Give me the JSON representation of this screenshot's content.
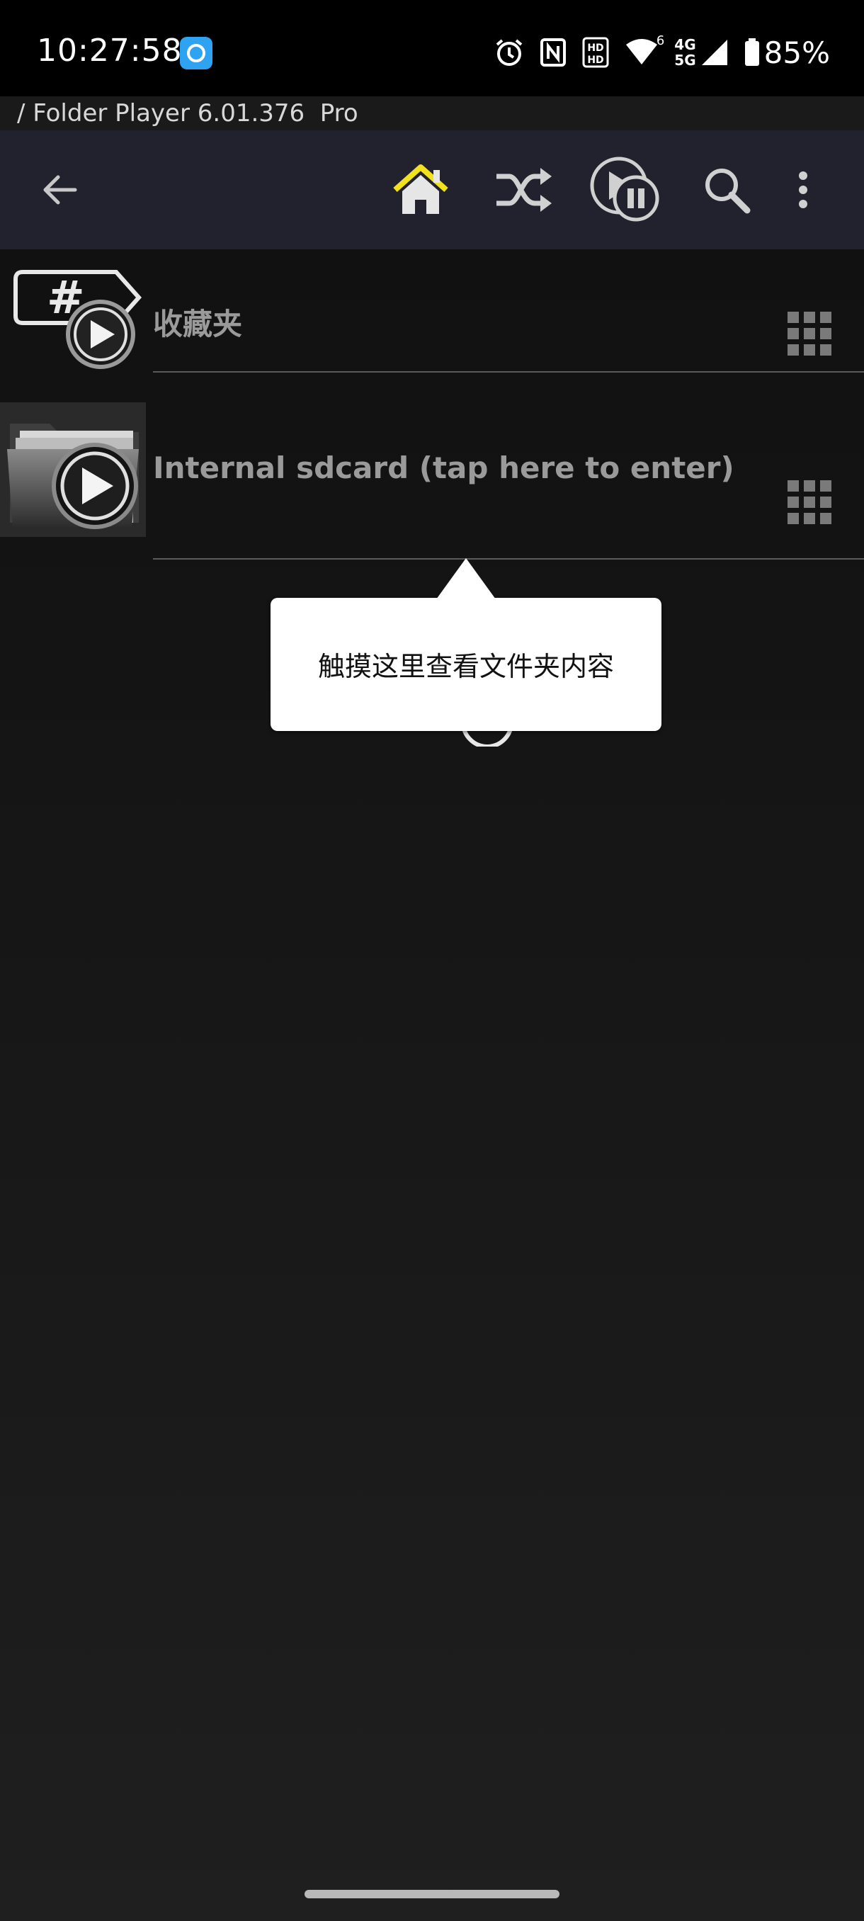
{
  "status_bar": {
    "time": "10:27:58",
    "network_label_top": "4G",
    "network_label_bottom": "5G",
    "wifi_label": "6",
    "battery_percent": "85%",
    "icons": [
      "app-notification-icon",
      "alarm-icon",
      "nfc-icon",
      "sim-hd-icon",
      "wifi-icon",
      "cellular-signal-icon",
      "battery-icon"
    ]
  },
  "title_bar": {
    "path": "/ Folder Player 6.01.376  Pro"
  },
  "toolbar": {
    "icons": [
      "back-arrow-icon",
      "home-icon",
      "shuffle-icon",
      "play-pause-icon",
      "search-icon",
      "more-vert-icon"
    ],
    "home_color": "#f2e11f"
  },
  "list": {
    "items": [
      {
        "label": "收藏夹",
        "icon": "tag-play-icon"
      },
      {
        "label": "Internal sdcard (tap here to enter)",
        "icon": "folder-play-icon"
      }
    ]
  },
  "tooltip": {
    "text": "触摸这里查看文件夹内容"
  }
}
